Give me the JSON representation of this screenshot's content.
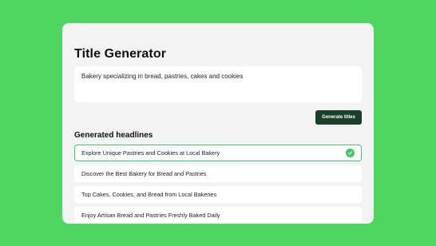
{
  "app": {
    "title": "Title Generator"
  },
  "prompt": {
    "value": "Bakery specializing in bread, pastries, cakes and cookies"
  },
  "actions": {
    "generate_label": "Generate titles"
  },
  "results": {
    "heading": "Generated headlines",
    "items": [
      {
        "label": "Explore Unique Pastries and Cookies at Local Bakery",
        "selected": true
      },
      {
        "label": "Discover the Best Bakery for Bread and Pastries",
        "selected": false
      },
      {
        "label": "Top Cakes, Cookies, and Bread from Local Bakeries",
        "selected": false
      },
      {
        "label": "Enjoy Artisan Bread and Pastries Freshly Baked Daily",
        "selected": false
      }
    ]
  },
  "colors": {
    "background": "#4fd660",
    "button": "#1b3f2a",
    "accent": "#3fc95a"
  },
  "icons": {
    "selected": "check-circle-icon"
  }
}
